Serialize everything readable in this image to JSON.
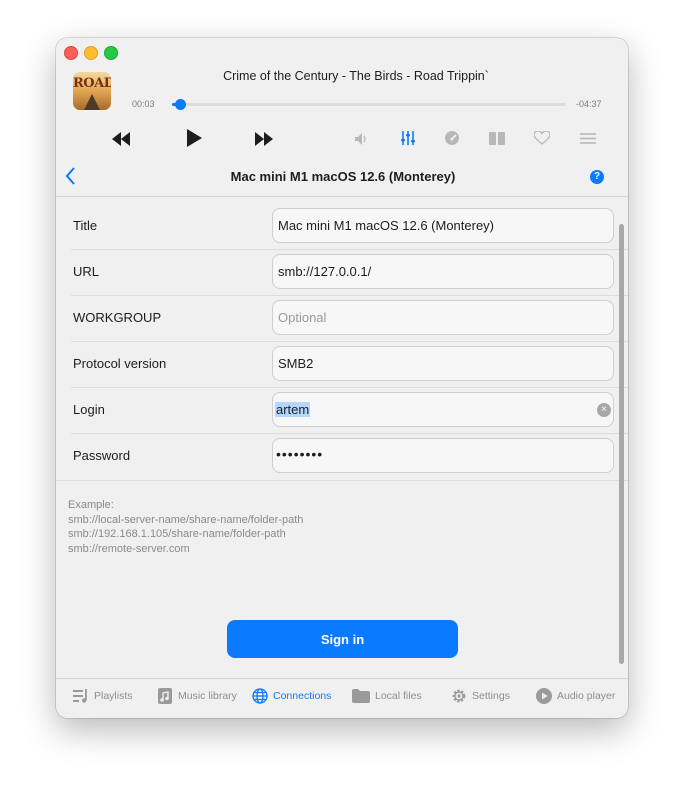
{
  "player": {
    "track_title": "Crime of the Century - The Birds - Road Trippin`",
    "album_art_text": "ROAD",
    "elapsed": "00:03",
    "remaining": "-04:37",
    "progress_fraction": 0.012
  },
  "header": {
    "title": "Mac mini M1 macOS 12.6 (Monterey)",
    "help_glyph": "?"
  },
  "form": {
    "rows": [
      {
        "label": "Title",
        "value": "Mac mini M1 macOS 12.6 (Monterey)",
        "placeholder": ""
      },
      {
        "label": "URL",
        "value": "smb://127.0.0.1/",
        "placeholder": ""
      },
      {
        "label": "WORKGROUP",
        "value": "",
        "placeholder": "Optional"
      },
      {
        "label": "Protocol version",
        "value": "SMB2"
      },
      {
        "label": "Login",
        "value": "artem"
      },
      {
        "label": "Password",
        "value": "••••••••"
      }
    ]
  },
  "example": {
    "heading": "Example:",
    "lines": [
      "smb://local-server-name/share-name/folder-path",
      "smb://192.168.1.105/share-name/folder-path",
      "smb://remote-server.com"
    ]
  },
  "signin_label": "Sign in",
  "tabs": [
    {
      "label": "Playlists",
      "icon": "playlist-icon"
    },
    {
      "label": "Music library",
      "icon": "music-library-icon"
    },
    {
      "label": "Connections",
      "icon": "globe-icon",
      "active": true
    },
    {
      "label": "Local files",
      "icon": "folder-icon"
    },
    {
      "label": "Settings",
      "icon": "gear-icon"
    },
    {
      "label": "Audio player",
      "icon": "play-circle-icon"
    }
  ],
  "colors": {
    "accent": "#0a7aff",
    "inactive": "#8e8e8e"
  }
}
